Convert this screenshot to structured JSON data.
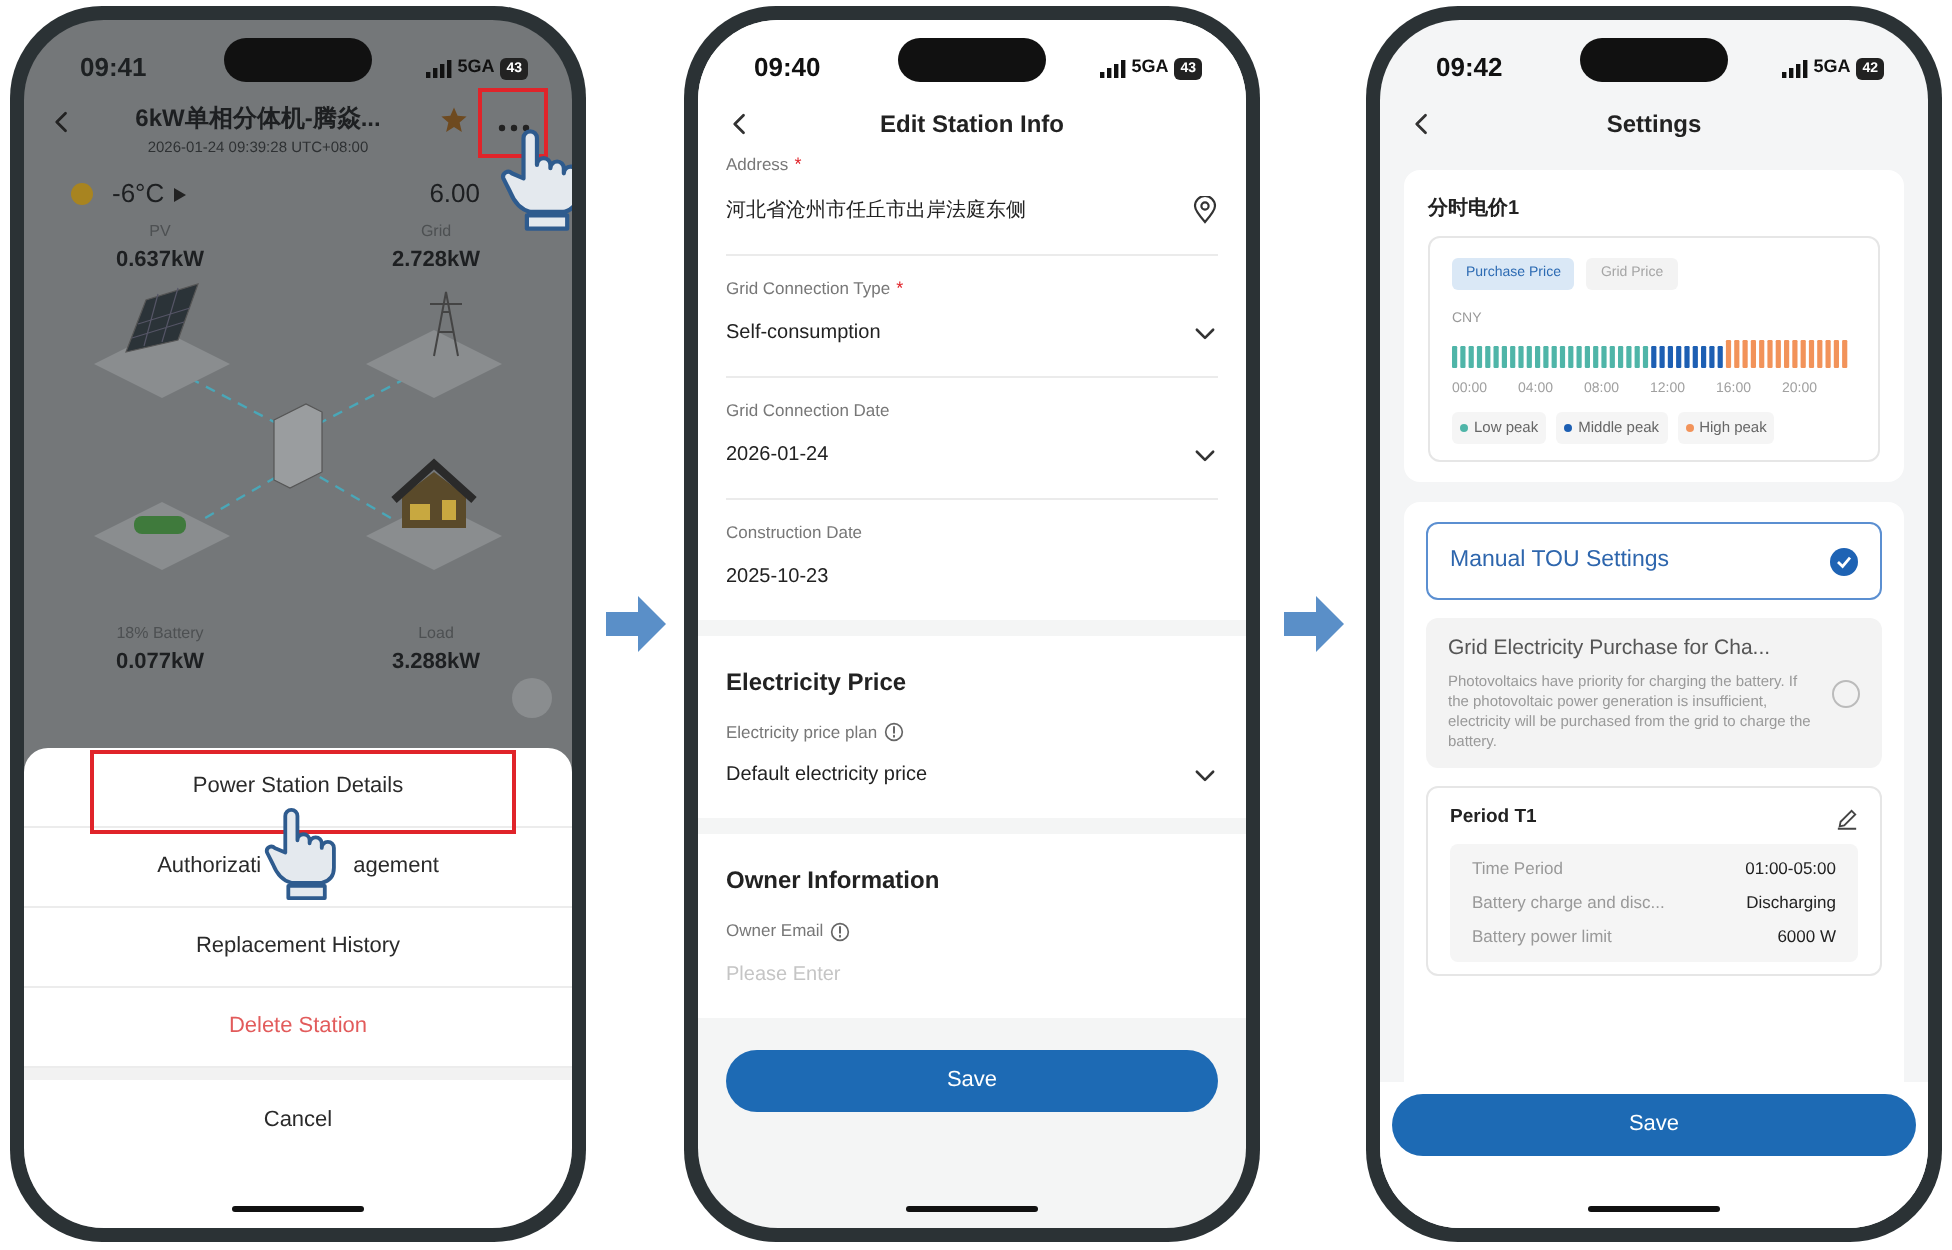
{
  "screen_1": {
    "status_bar": {
      "time": "09:41",
      "network": "5GA",
      "battery": "43"
    },
    "header": {
      "title": "6kW单相分体机-腾焱...",
      "subtitle": "2026-01-24 09:39:28 UTC+08:00",
      "favorite": true,
      "more_highlighted": true
    },
    "weather": {
      "temperature": "-6°C",
      "power": "6.00"
    },
    "flows": [
      {
        "label": "PV",
        "value": "0.637kW"
      },
      {
        "label": "Grid",
        "value": "2.728kW"
      },
      {
        "label": "18% Battery",
        "value": "0.077kW"
      },
      {
        "label": "Load",
        "value": "3.288kW"
      }
    ],
    "action_sheet": {
      "items": [
        {
          "label": "Power Station Details",
          "kind": "normal",
          "highlighted": true
        },
        {
          "label": "Authorizati",
          "label_tail": "agement",
          "kind": "normal",
          "highlighted": false
        },
        {
          "label": "Replacement History",
          "kind": "normal",
          "highlighted": false
        },
        {
          "label": "Delete Station",
          "kind": "danger",
          "highlighted": false
        }
      ],
      "cancel": "Cancel"
    }
  },
  "screen_2": {
    "status_bar": {
      "time": "09:40",
      "network": "5GA",
      "battery": "43"
    },
    "title": "Edit Station Info",
    "fields": [
      {
        "label": "Address",
        "required_mark": "*",
        "value": "河北省沧州市任丘市出岸法庭东侧",
        "kind": "location"
      },
      {
        "label": "Grid Connection Type",
        "required_mark": "*",
        "value": "Self-consumption",
        "kind": "select"
      },
      {
        "label": "Grid Connection Date",
        "value": "2026-01-24",
        "kind": "select"
      },
      {
        "label": "Construction Date",
        "value": "2025-10-23",
        "kind": "text"
      }
    ],
    "sections": [
      {
        "title": "Electricity Price",
        "fields": [
          {
            "label": "Electricity price plan",
            "info": true,
            "value": "Default electricity price",
            "kind": "select"
          }
        ]
      },
      {
        "title": "Owner Information",
        "fields": [
          {
            "label": "Owner Email",
            "info": true,
            "placeholder": "Please Enter",
            "kind": "input"
          }
        ]
      }
    ],
    "save_button": "Save"
  },
  "screen_3": {
    "status_bar": {
      "time": "09:42",
      "network": "5GA",
      "battery": "42"
    },
    "title": "Settings",
    "price_card": {
      "title": "分时电价1",
      "tabs": [
        {
          "label": "Purchase Price",
          "selected": true
        },
        {
          "label": "Grid Price",
          "selected": false
        }
      ],
      "unit": "CNY",
      "time_labels": [
        "00:00",
        "04:00",
        "08:00",
        "12:00",
        "16:00",
        "20:00"
      ],
      "legend": [
        {
          "label": "Low peak",
          "color": "#4fb5a8"
        },
        {
          "label": "Middle peak",
          "color": "#1d5fb3"
        },
        {
          "label": "High peak",
          "color": "#f2935a"
        }
      ]
    },
    "modes": [
      {
        "title": "Manual TOU Settings",
        "selected": true
      },
      {
        "title": "Grid Electricity Purchase for Cha...",
        "description": "Photovoltaics have priority for charging the battery. If the photovoltaic power generation is insufficient, electricity will be purchased from the grid to charge the battery.",
        "selected": false
      }
    ],
    "period": {
      "title": "Period T1",
      "rows": [
        {
          "label": "Time Period",
          "value": "01:00-05:00"
        },
        {
          "label": "Battery charge and disc...",
          "value": "Discharging"
        },
        {
          "label": "Battery power limit",
          "value": "6000 W"
        }
      ]
    },
    "save_button": "Save"
  }
}
